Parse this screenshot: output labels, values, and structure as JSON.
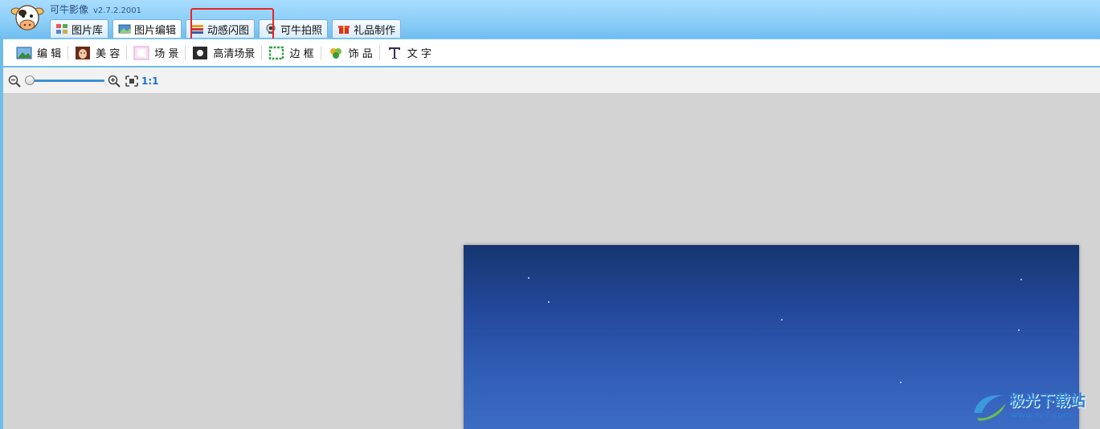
{
  "app": {
    "title": "可牛影像",
    "version": "v2.7.2.2001"
  },
  "tabs": [
    {
      "label": "图片库",
      "icon": "photo-library-icon"
    },
    {
      "label": "图片编辑",
      "icon": "photo-edit-icon"
    },
    {
      "label": "动感闪图",
      "icon": "gif-frames-icon"
    },
    {
      "label": "可牛拍照",
      "icon": "webcam-icon"
    },
    {
      "label": "礼品制作",
      "icon": "gift-icon"
    }
  ],
  "tools": [
    {
      "label": "编 辑",
      "icon": "landscape-icon"
    },
    {
      "label": "美 容",
      "icon": "face-icon"
    },
    {
      "label": "场 景",
      "icon": "scene-icon"
    },
    {
      "label": "高清场景",
      "icon": "hd-scene-icon"
    },
    {
      "label": "边 框",
      "icon": "frame-icon"
    },
    {
      "label": "饰 品",
      "icon": "clover-icon"
    },
    {
      "label": "文 字",
      "icon": "text-icon"
    }
  ],
  "zoom": {
    "ratio_label": "1:1",
    "level": 0.0
  },
  "watermark": {
    "text": "极光下载站",
    "url": "www.xz7.com"
  },
  "colors": {
    "accent": "#6fbde9",
    "highlight": "#e8242a",
    "canvas": "#d3d3d3"
  }
}
